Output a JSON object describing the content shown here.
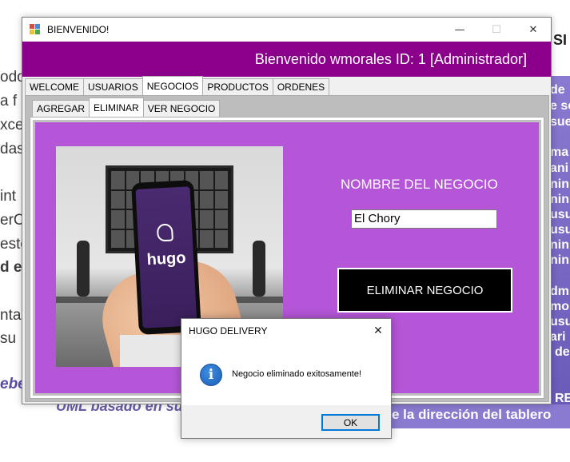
{
  "background": {
    "left_fragments": [
      "odo",
      "a  f",
      "xce",
      "das",
      "int",
      "erC",
      "estc",
      "d es",
      "nta",
      "su"
    ],
    "right_fragments": [
      "de",
      "e so",
      "sue",
      "ma",
      "ani",
      "nin",
      "nin",
      "usu",
      "usu",
      "nin",
      "nin",
      "dm",
      "mo",
      "usu",
      "ari",
      "de",
      "RE"
    ],
    "top_right": "SI",
    "bottom_left": "ebe",
    "bottom_line": "UML basado en su",
    "bottom_strip": "e la dirección del tablero"
  },
  "window": {
    "title": "BIENVENIDO!",
    "minimize_glyph": "—",
    "maximize_glyph": "☐",
    "close_glyph": "✕",
    "header_text": "Bienvenido wmorales  ID: 1  [Administrador]",
    "main_tabs": [
      {
        "label": "WELCOME"
      },
      {
        "label": "USUARIOS"
      },
      {
        "label": "NEGOCIOS"
      },
      {
        "label": "PRODUCTOS"
      },
      {
        "label": "ORDENES"
      }
    ],
    "sub_tabs": [
      {
        "label": "AGREGAR"
      },
      {
        "label": "ELIMINAR"
      },
      {
        "label": "VER NEGOCIO"
      }
    ],
    "image_brand": "hugo",
    "nombre_label": "NOMBRE DEL NEGOCIO",
    "nombre_value": "El Chory",
    "eliminar_button": "ELIMINAR NEGOCIO"
  },
  "dialog": {
    "title": "HUGO DELIVERY",
    "close_glyph": "✕",
    "icon": "info-icon",
    "icon_glyph": "i",
    "message": "Negocio eliminado exitosamente!",
    "ok_label": "OK"
  },
  "colors": {
    "header": "#8b008b",
    "panel": "#b556d8",
    "button": "#000000",
    "ok_border": "#0078d7"
  }
}
